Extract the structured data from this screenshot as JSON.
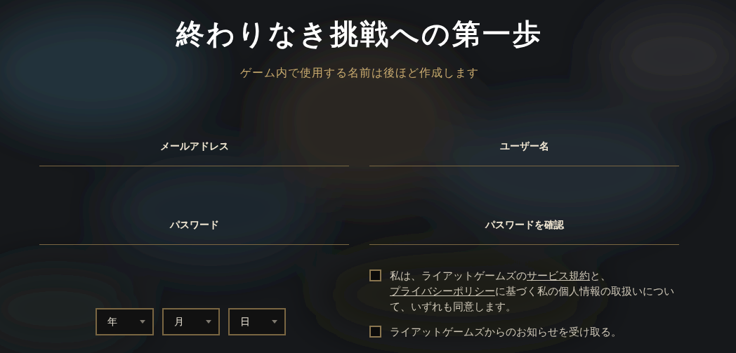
{
  "title": "終わりなき挑戦への第一歩",
  "subtitle": "ゲーム内で使用する名前は後ほど作成します",
  "fields": [
    {
      "placeholder": "メールアドレス"
    },
    {
      "placeholder": "ユーザー名"
    },
    {
      "placeholder": "パスワード"
    },
    {
      "placeholder": "パスワードを確認"
    }
  ],
  "birthdate": [
    {
      "label": "年"
    },
    {
      "label": "月"
    },
    {
      "label": "日"
    }
  ],
  "checkboxes": [
    {
      "checked": false,
      "parts": [
        {
          "kind": "text",
          "text": "私は、ライアットゲームズの"
        },
        {
          "kind": "link",
          "text": "サービス規約"
        },
        {
          "kind": "text",
          "text": "と、"
        },
        {
          "kind": "link",
          "text": "プライバシーポリシー"
        },
        {
          "kind": "text",
          "text": "に基づく私の個人情報の取扱いについて、いずれも同意します。"
        }
      ]
    },
    {
      "checked": false,
      "parts": [
        {
          "kind": "text",
          "text": "ライアットゲームズからのお知らせを受け取る。"
        }
      ]
    }
  ]
}
